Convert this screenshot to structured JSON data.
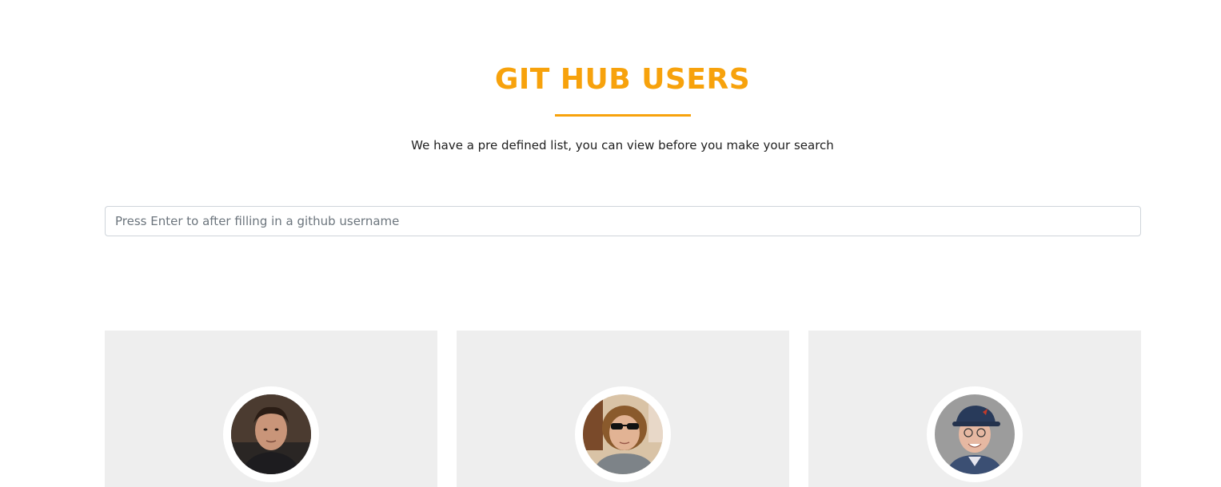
{
  "header": {
    "title": "GIT HUB USERS",
    "subtitle": "We have a pre defined list, you can view before you make your search"
  },
  "search": {
    "placeholder": "Press Enter to after filling in a github username",
    "value": ""
  },
  "colors": {
    "accent": "#f7a20c",
    "card_background": "#eeeeee",
    "text": "#212121"
  },
  "users": [
    {
      "avatar_icon": "user-avatar-photo"
    },
    {
      "avatar_icon": "user-avatar-photo"
    },
    {
      "avatar_icon": "user-avatar-photo"
    }
  ]
}
